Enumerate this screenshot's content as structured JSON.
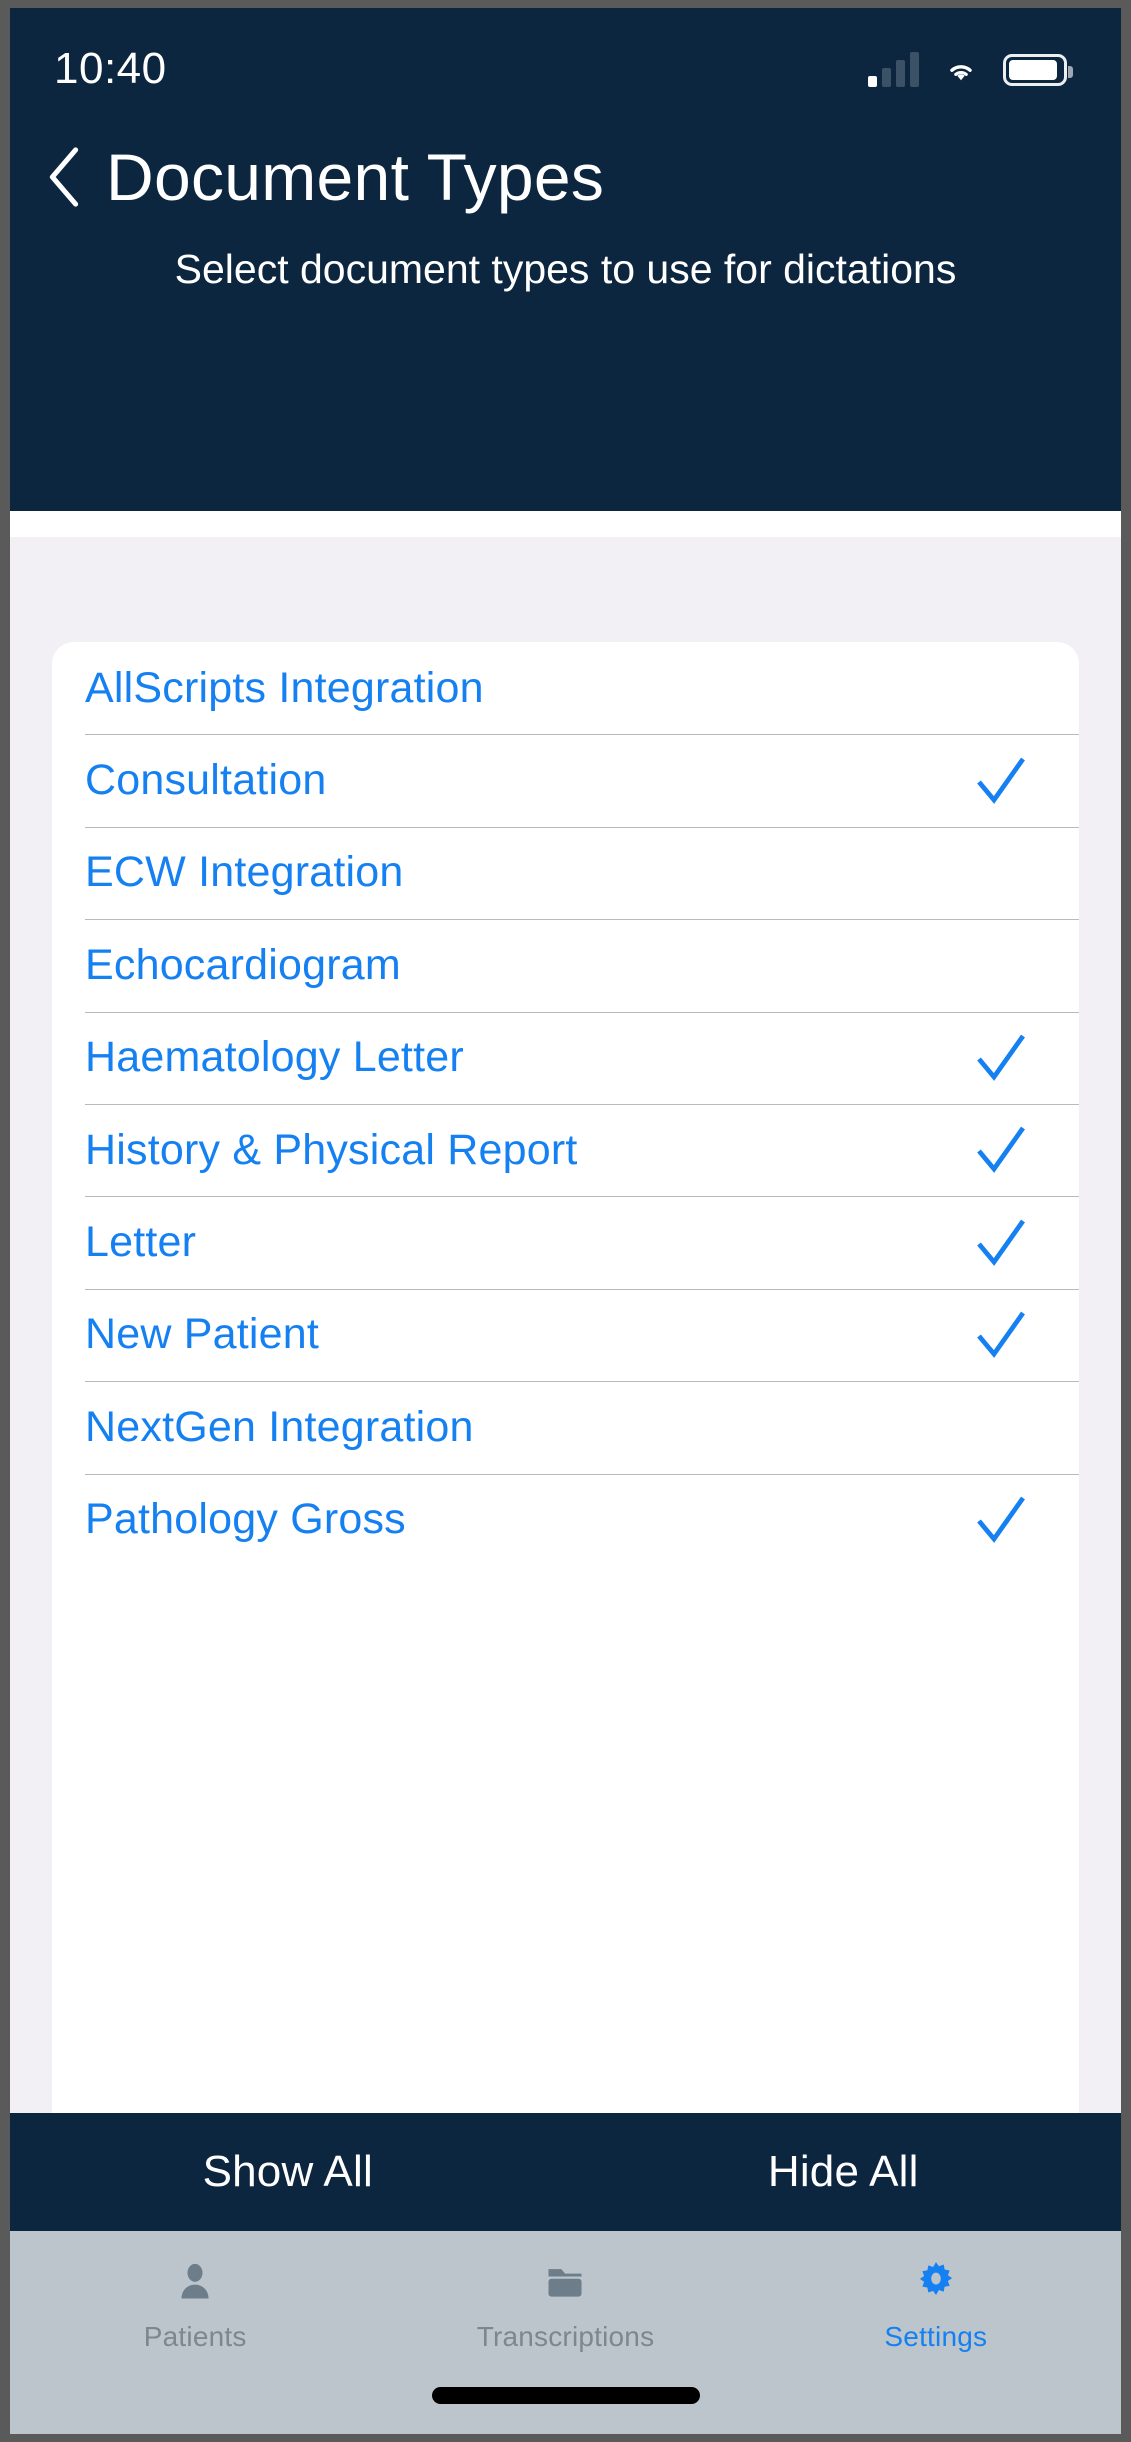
{
  "status_bar": {
    "time": "10:40",
    "cellular_icon": "cellular-signal-icon",
    "wifi_icon": "wifi-icon",
    "battery_icon": "battery-icon"
  },
  "header": {
    "back_icon": "chevron-left-icon",
    "title": "Document Types",
    "subtitle": "Select document types to use for dictations",
    "background_color": "#0d2640"
  },
  "colors": {
    "accent_blue": "#1580f2",
    "page_background": "#f2f0f5",
    "card_background": "#ffffff",
    "tabbar_background": "#bcc5cb",
    "inactive_tab": "#7b8791"
  },
  "document_types": [
    {
      "label": "AllScripts Integration",
      "selected": false
    },
    {
      "label": "Consultation",
      "selected": true
    },
    {
      "label": "ECW Integration",
      "selected": false
    },
    {
      "label": "Echocardiogram",
      "selected": false
    },
    {
      "label": "Haematology Letter",
      "selected": true
    },
    {
      "label": "History & Physical Report",
      "selected": true
    },
    {
      "label": "Letter",
      "selected": true
    },
    {
      "label": "New Patient",
      "selected": true
    },
    {
      "label": "NextGen Integration",
      "selected": false
    },
    {
      "label": "Pathology Gross",
      "selected": true
    }
  ],
  "actions": {
    "show_all": "Show All",
    "hide_all": "Hide All"
  },
  "tabs": [
    {
      "label": "Patients",
      "icon": "person-icon",
      "active": false
    },
    {
      "label": "Transcriptions",
      "icon": "folder-icon",
      "active": false
    },
    {
      "label": "Settings",
      "icon": "gear-icon",
      "active": true
    }
  ]
}
